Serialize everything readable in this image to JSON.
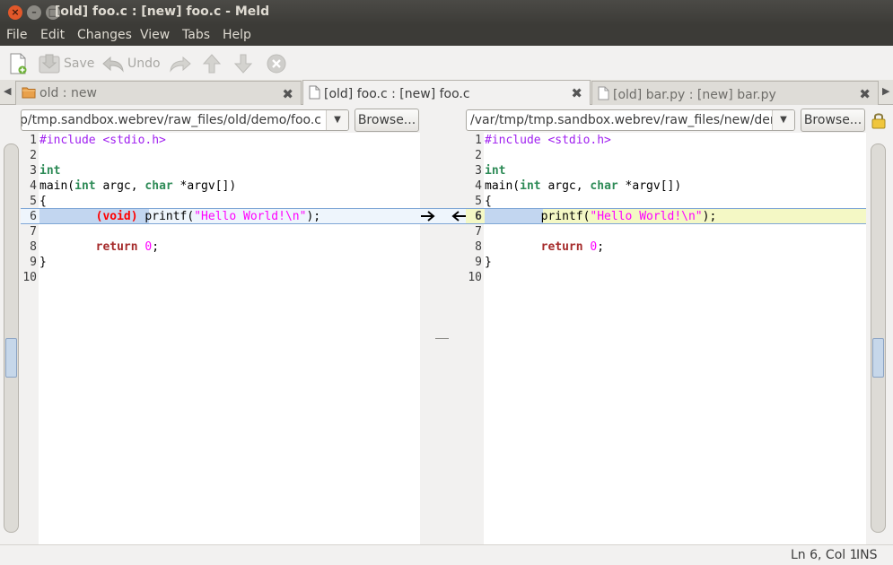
{
  "window": {
    "title": "[old] foo.c : [new] foo.c - Meld",
    "buttons": [
      "close",
      "minimize",
      "maximize"
    ]
  },
  "menu": [
    "File",
    "Edit",
    "Changes",
    "View",
    "Tabs",
    "Help"
  ],
  "toolbar": {
    "new_icon": "new-document-icon",
    "save_label": "Save",
    "undo_label": "Undo",
    "redo_icon": "redo-icon",
    "up_icon": "arrow-up-icon",
    "down_icon": "arrow-down-icon",
    "stop_icon": "stop-icon"
  },
  "tabs": [
    {
      "label": "old : new",
      "icon": "folder-icon",
      "active": false
    },
    {
      "label": "[old] foo.c : [new] foo.c",
      "icon": "document-icon",
      "active": true
    },
    {
      "label": "[old] bar.py : [new] bar.py",
      "icon": "document-icon",
      "active": false
    }
  ],
  "left_pane": {
    "path": "/var/tmp/tmp.sandbox.webrev/raw_files/old/demo/foo.c",
    "browse_label": "Browse..."
  },
  "right_pane": {
    "path": "/var/tmp/tmp.sandbox.webrev/raw_files/new/demo/foo.c",
    "browse_label": "Browse...",
    "lock_icon": "lock-icon"
  },
  "line_numbers": [
    "1",
    "2",
    "3",
    "4",
    "5",
    "6",
    "7",
    "8",
    "9",
    "10"
  ],
  "status": {
    "position": "Ln 6, Col 1",
    "mode": "INS"
  },
  "colors": {
    "changed_line_left": "#eef5fc",
    "changed_line_right": "#f4f8c5",
    "changed_highlight": "#c2d6f0",
    "titlebar": "#3c3b37"
  }
}
